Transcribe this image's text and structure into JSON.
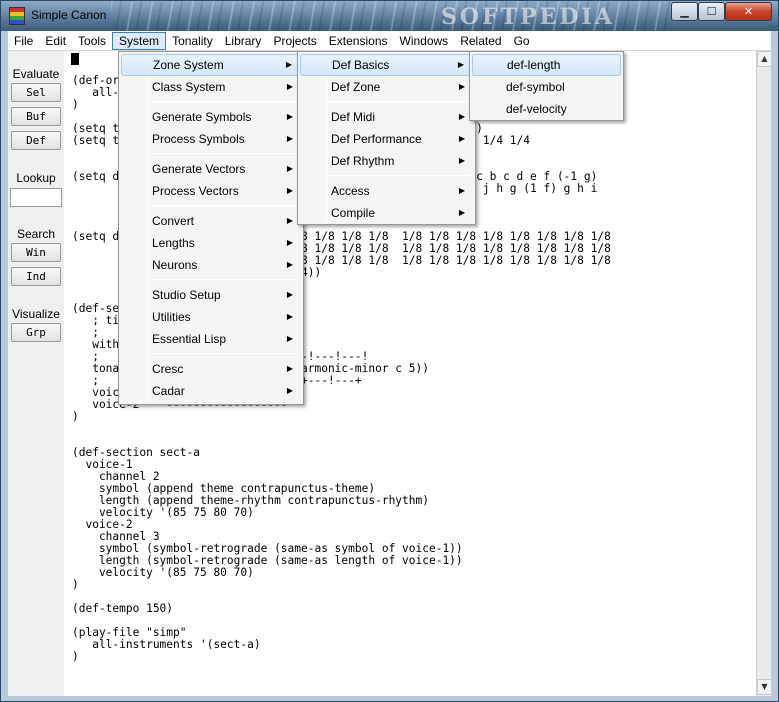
{
  "window": {
    "title": "Simple Canon",
    "watermark": "SOFTPEDIA",
    "controls": {
      "minimize": "▁",
      "maximize": "☐",
      "close": "✕"
    }
  },
  "menubar": [
    "File",
    "Edit",
    "Tools",
    "System",
    "Tonality",
    "Library",
    "Projects",
    "Extensions",
    "Windows",
    "Related",
    "Go"
  ],
  "menubar_open": "System",
  "left_panel": {
    "evaluate_label": "Evaluate",
    "evaluate_buttons": [
      "Sel",
      "Buf",
      "Def"
    ],
    "lookup_label": "Lookup",
    "search_label": "Search",
    "search_buttons": [
      "Win",
      "Ind"
    ],
    "visualize_label": "Visualize",
    "visualize_buttons": [
      "Grp"
    ]
  },
  "editor": {
    "code": "(def-or\n   all-\n)\n\n(setq t                                    ) -d a d c b a c))\n(setq t                                  2/4 2/4 1/4 1/4 1/4 1/4 1/4\n\n\n(setq d                                   c d e f b c d e d c b c d e f (-1 g)\n                                          g) f e (1 f) g h i j h g (1 f) g h i\n                                          c a))\n\n\n(setq d                 1/8 1/8 1/8 1/8 1/8 1/8  1/8 1/8 1/8 1/8 1/8 1/8 1/8 1/8\n                        1/8 1/8 1/8 1/8 1/8 1/8  1/8 1/8 1/8 1/8 1/8 1/8 1/8 1/8\n                        1/8 1/8 1/8 1/8 1/8 1/8  1/8 1/8 1/8 1/8 1/8 1/8 1/8 1/8\n                        1/4 1/4 1/4))\n\n\n(def-se\n   ; ti\n   ;\n   with\n   ;                          -!---!---!---!\n   tona                      ty (harmonic-minor c 5))\n   ;                          !---+---!---+\n   voice-1\n   voice-2   \"------------------\"\n)\n\n\n(def-section sect-a\n  voice-1\n    channel 2\n    symbol (append theme contrapunctus-theme)\n    length (append theme-rhythm contrapunctus-rhythm)\n    velocity '(85 75 80 70)\n  voice-2\n    channel 3\n    symbol (symbol-retrograde (same-as symbol of voice-1))\n    length (symbol-retrograde (same-as length of voice-1))\n    velocity '(85 75 80 70)\n)\n\n(def-tempo 150)\n\n(play-file \"simp\"\n   all-instruments '(sect-a)\n)"
  },
  "system_menu": {
    "items": [
      {
        "label": "Zone System",
        "submenu": true,
        "highlighted": true
      },
      {
        "label": "Class System",
        "submenu": true
      },
      {
        "label": "Generate Symbols",
        "submenu": true
      },
      {
        "label": "Process Symbols",
        "submenu": true
      },
      {
        "label": "Generate Vectors",
        "submenu": true
      },
      {
        "label": "Process Vectors",
        "submenu": true
      },
      {
        "label": "Convert",
        "submenu": true
      },
      {
        "label": "Lengths",
        "submenu": true
      },
      {
        "label": "Neurons",
        "submenu": true
      },
      {
        "label": "Studio Setup",
        "submenu": true
      },
      {
        "label": "Utilities",
        "submenu": true
      },
      {
        "label": "Essential Lisp",
        "submenu": true
      },
      {
        "label": "Cresc",
        "submenu": true
      },
      {
        "label": "Cadar",
        "submenu": true
      }
    ]
  },
  "zone_menu": {
    "items": [
      {
        "label": "Def Basics",
        "submenu": true,
        "highlighted": true
      },
      {
        "label": "Def Zone",
        "submenu": true
      },
      {
        "label": "Def Midi",
        "submenu": true
      },
      {
        "label": "Def Performance",
        "submenu": true
      },
      {
        "label": "Def Rhythm",
        "submenu": true
      },
      {
        "label": "Access",
        "submenu": true
      },
      {
        "label": "Compile",
        "submenu": true
      }
    ]
  },
  "basics_menu": {
    "items": [
      {
        "label": "def-length",
        "highlighted": true
      },
      {
        "label": "def-symbol"
      },
      {
        "label": "def-velocity"
      }
    ]
  },
  "icons": {
    "app": "app-icon",
    "submenu_arrow": "▶",
    "scroll_up": "▲",
    "scroll_down": "▼"
  }
}
